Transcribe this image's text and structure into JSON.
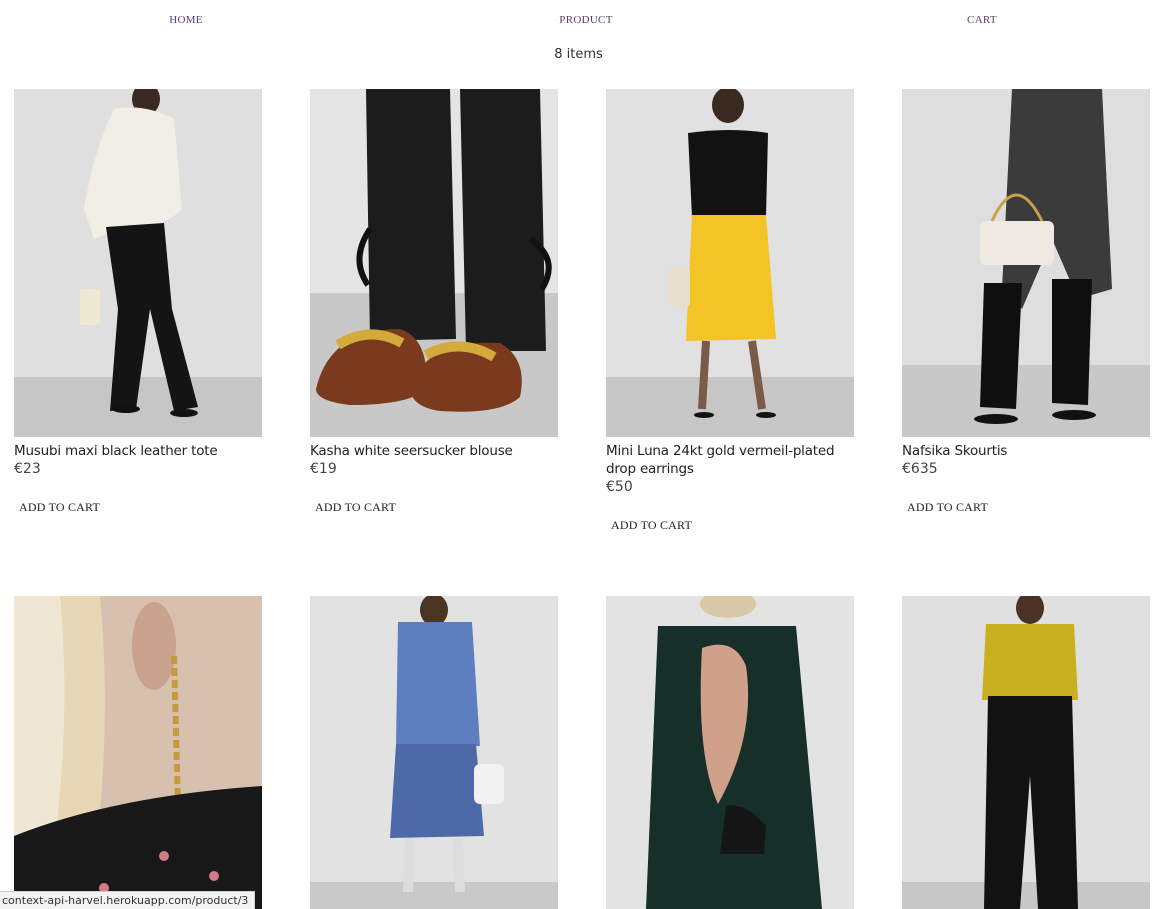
{
  "nav": {
    "home": "HOME",
    "product": "PRODUCT",
    "cart": "CART"
  },
  "items_count": "8 items",
  "add_label": "ADD TO CART",
  "products": [
    {
      "name": "Musubi maxi black leather tote",
      "price": "€23"
    },
    {
      "name": "Kasha white seersucker blouse",
      "price": "€19"
    },
    {
      "name": "Mini Luna 24kt gold vermeil-plated drop earrings",
      "price": "€50"
    },
    {
      "name": "Nafsika Skourtis",
      "price": "€635"
    },
    {
      "name": "",
      "price": ""
    },
    {
      "name": "",
      "price": ""
    },
    {
      "name": "",
      "price": ""
    },
    {
      "name": "",
      "price": ""
    }
  ],
  "status_url": "context-api-harvel.herokuapp.com/product/3"
}
